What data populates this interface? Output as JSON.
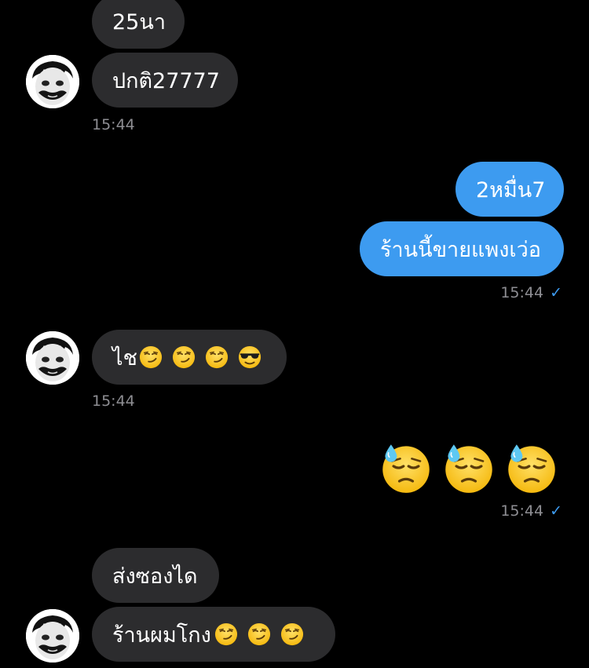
{
  "messages": {
    "m1": {
      "text": "25นา"
    },
    "m2": {
      "text": "ปกติ27777"
    },
    "ts1": "15:44",
    "m3": {
      "text": "2หมื่น7"
    },
    "m4": {
      "text": "ร้านนี้ขายแพงเว่อ"
    },
    "ts2": "15:44",
    "m5": {
      "text": "ไช",
      "emojis": [
        "smirk-emoji",
        "smirk-emoji",
        "smirk-emoji",
        "sunglasses-emoji"
      ]
    },
    "ts3": "15:44",
    "big_emojis": [
      "downcast-sweat-emoji",
      "downcast-sweat-emoji",
      "downcast-sweat-emoji"
    ],
    "ts4": "15:44",
    "m6": {
      "text": "ส่งซองได"
    },
    "m7": {
      "text": "ร้านผมโกง",
      "emojis": [
        "smirk-emoji",
        "smirk-emoji",
        "smirk-emoji"
      ]
    }
  },
  "read_mark": "✓",
  "colors": {
    "sent_bubble": "#3d9bf0",
    "received_bubble": "#2c2c2e",
    "timestamp": "#8e8e93",
    "background": "#000000"
  }
}
